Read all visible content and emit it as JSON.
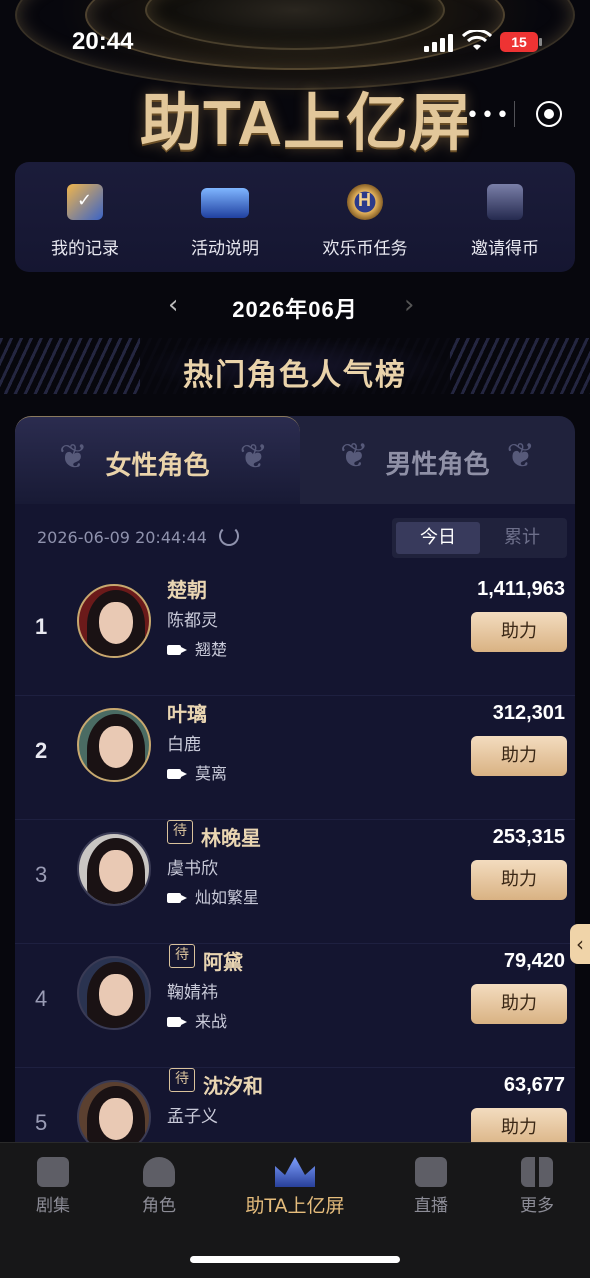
{
  "status": {
    "time": "20:44",
    "battery": "15"
  },
  "header": {
    "title": "助TA上亿屏"
  },
  "quick_menu": [
    {
      "label": "我的记录",
      "icon": "clipboard-icon"
    },
    {
      "label": "活动说明",
      "icon": "monitor-icon"
    },
    {
      "label": "欢乐币任务",
      "icon": "coin-icon"
    },
    {
      "label": "邀请得币",
      "icon": "invite-icon"
    }
  ],
  "month": {
    "text": "2026年06月"
  },
  "section": {
    "title": "热门角色人气榜"
  },
  "tabs": {
    "female": "女性角色",
    "male": "男性角色"
  },
  "list": {
    "timestamp": "2026-06-09 20:44:44",
    "segment": {
      "today": "今日",
      "total": "累计"
    },
    "pending_badge": "待",
    "help_label": "助力",
    "items": [
      {
        "rank": "1",
        "name": "楚朝",
        "actor": "陈都灵",
        "drama": "翘楚",
        "votes": "1,411,963",
        "pending": false
      },
      {
        "rank": "2",
        "name": "叶璃",
        "actor": "白鹿",
        "drama": "莫离",
        "votes": "312,301",
        "pending": false
      },
      {
        "rank": "3",
        "name": "林晚星",
        "actor": "虞书欣",
        "drama": "灿如繁星",
        "votes": "253,315",
        "pending": true
      },
      {
        "rank": "4",
        "name": "阿黛",
        "actor": "鞠婧祎",
        "drama": "来战",
        "votes": "79,420",
        "pending": true
      },
      {
        "rank": "5",
        "name": "沈汐和",
        "actor": "孟子义",
        "drama": "",
        "votes": "63,677",
        "pending": true
      }
    ]
  },
  "bottom_nav": [
    {
      "label": "剧集",
      "icon": "tv-play-icon"
    },
    {
      "label": "角色",
      "icon": "person-star-icon"
    },
    {
      "label": "助TA上亿屏",
      "icon": "crown-icon",
      "active": true
    },
    {
      "label": "直播",
      "icon": "tv-icon"
    },
    {
      "label": "更多",
      "icon": "grid-icon"
    }
  ]
}
